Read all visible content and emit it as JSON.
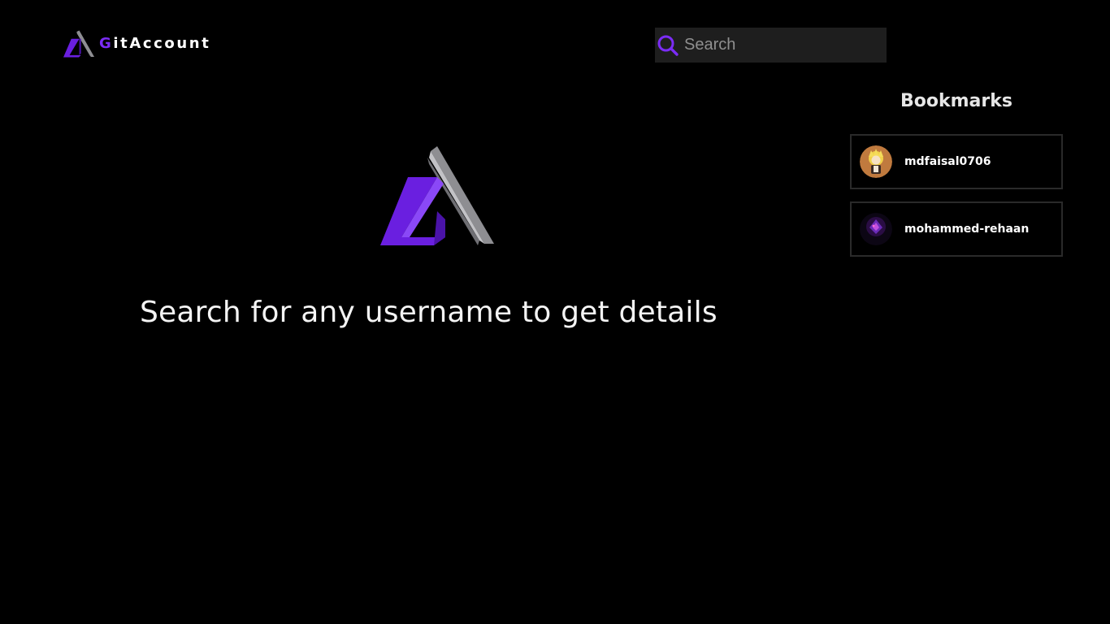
{
  "header": {
    "brand": {
      "first_letter": "G",
      "rest": "itAccount"
    },
    "search": {
      "placeholder": "Search",
      "value": ""
    }
  },
  "main": {
    "prompt": "Search for any username to get details"
  },
  "bookmarks": {
    "title": "Bookmarks",
    "items": [
      {
        "username": "mdfaisal0706",
        "avatar": "anime-character-avatar"
      },
      {
        "username": "mohammed-rehaan",
        "avatar": "purple-neon-avatar"
      }
    ]
  },
  "colors": {
    "accent": "#7b2cf5",
    "background": "#000000",
    "logo_gray": "#8e8e92"
  },
  "icons": {
    "search": "search-icon",
    "logo": "gitaccount-logo-icon"
  }
}
